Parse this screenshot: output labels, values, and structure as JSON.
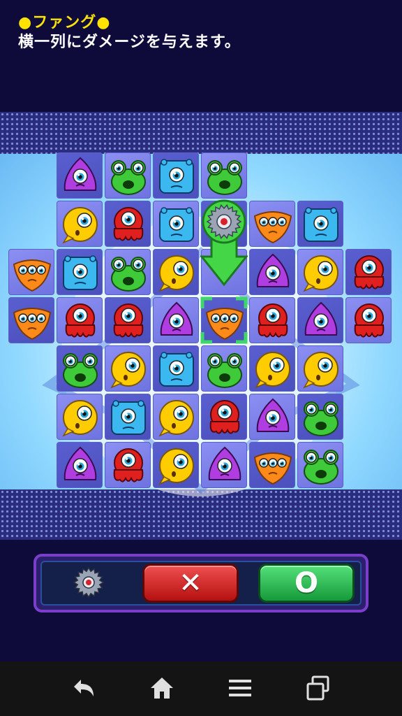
{
  "header": {
    "skill_name": "●ファング●",
    "skill_description": "横一列にダメージを与えます。"
  },
  "board": {
    "rows": [
      [
        null,
        "purple",
        "green",
        "blue",
        "green",
        null,
        null,
        null
      ],
      [
        null,
        "yellow",
        "red",
        "blue",
        "gear",
        "orange",
        "blue",
        null
      ],
      [
        "orange",
        "blue",
        "green",
        "yellow",
        "arrow",
        "purple",
        "yellow",
        "red"
      ],
      [
        "orange",
        "red",
        "red",
        "purple",
        "orange",
        "red",
        "purple",
        "red"
      ],
      [
        null,
        "green",
        "yellow",
        "blue",
        "green",
        "yellow",
        "yellow",
        null
      ],
      [
        null,
        "yellow",
        "blue",
        "yellow",
        "red",
        "purple",
        "green",
        null
      ],
      [
        null,
        "purple",
        "red",
        "yellow",
        "purple",
        "orange",
        "green",
        null
      ]
    ],
    "selected_cell": {
      "row": 3,
      "col": 4
    },
    "colors": {
      "purple": "#b03de0",
      "green": "#3fca3a",
      "blue": "#3ab8ef",
      "yellow": "#ffcc00",
      "red": "#e0201e",
      "orange": "#ff8a1a",
      "cursor": "#3cd66a",
      "arrow": "#45d648"
    },
    "icon_names": {
      "purple": "purple-blob-monster-icon",
      "green": "green-frog-monster-icon",
      "blue": "blue-cube-monster-icon",
      "yellow": "yellow-round-monster-icon",
      "red": "red-octopus-monster-icon",
      "orange": "orange-three-eyed-monster-icon",
      "gear": "sawblade-gear-icon"
    }
  },
  "controls": {
    "skill_icon": "sawblade-gear-icon",
    "cancel_label": "✕",
    "ok_label": "O",
    "cancel_color": "#d42222",
    "ok_color": "#2ecc55"
  },
  "navbar": {
    "items": [
      "back-icon",
      "home-icon",
      "menu-icon",
      "recent-apps-icon"
    ]
  }
}
